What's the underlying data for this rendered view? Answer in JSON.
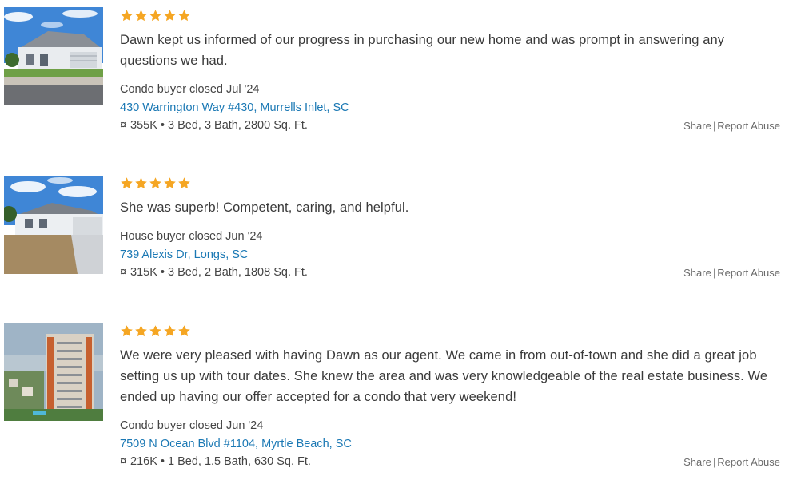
{
  "rating_color": "#f5a623",
  "link_color": "#1a78b4",
  "reviews": [
    {
      "stars": 5,
      "text": "Dawn kept us informed of our progress in purchasing our new home and was prompt in answering any questions we had.",
      "buyer": "Condo buyer closed Jul '24",
      "address": "430 Warrington Way #430, Murrells Inlet, SC",
      "currency_symbol": "¤",
      "details": "355K • 3 Bed, 3 Bath, 2800 Sq. Ft.",
      "share": "Share",
      "separator": "|",
      "report": "Report Abuse"
    },
    {
      "stars": 5,
      "text": "She was superb! Competent, caring, and helpful.",
      "buyer": "House buyer closed Jun '24",
      "address": "739 Alexis Dr, Longs, SC",
      "currency_symbol": "¤",
      "details": "315K • 3 Bed, 2 Bath, 1808 Sq. Ft.",
      "share": "Share",
      "separator": "|",
      "report": "Report Abuse"
    },
    {
      "stars": 5,
      "text": "We were very pleased with having Dawn as our agent. We came in from out-of-town and she did a great job setting us up with tour dates. She knew the area and was very knowledgeable of the real estate business. We ended up having our offer accepted for a condo that very weekend!",
      "buyer": "Condo buyer closed Jun '24",
      "address": "7509 N Ocean Blvd #1104, Myrtle Beach, SC",
      "currency_symbol": "¤",
      "details": "216K • 1 Bed, 1.5 Bath, 630 Sq. Ft.",
      "share": "Share",
      "separator": "|",
      "report": "Report Abuse"
    }
  ]
}
